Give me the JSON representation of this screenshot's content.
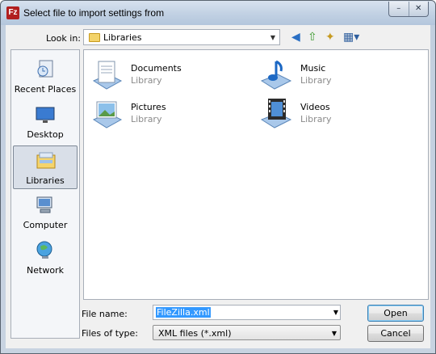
{
  "window": {
    "title": "Select file to import settings from",
    "app_icon": "Fz",
    "controls": [
      "–",
      "✕"
    ]
  },
  "lookin": {
    "label": "Look in:",
    "value": "Libraries"
  },
  "toolbar": {
    "back": "◀",
    "up": "⇧",
    "new_folder": "✦",
    "views": "▦▾"
  },
  "places": [
    {
      "label": "Recent Places",
      "icon": "recent-places-icon"
    },
    {
      "label": "Desktop",
      "icon": "desktop-icon"
    },
    {
      "label": "Libraries",
      "icon": "libraries-icon",
      "selected": true
    },
    {
      "label": "Computer",
      "icon": "computer-icon"
    },
    {
      "label": "Network",
      "icon": "network-icon"
    }
  ],
  "items": [
    {
      "name": "Documents",
      "sub": "Library",
      "icon": "documents-library-icon"
    },
    {
      "name": "Music",
      "sub": "Library",
      "icon": "music-library-icon"
    },
    {
      "name": "Pictures",
      "sub": "Library",
      "icon": "pictures-library-icon"
    },
    {
      "name": "Videos",
      "sub": "Library",
      "icon": "videos-library-icon"
    }
  ],
  "file_name": {
    "label": "File name:",
    "value": "FileZilla.xml"
  },
  "file_type": {
    "label": "Files of type:",
    "value": "XML files (*.xml)"
  },
  "buttons": {
    "open": "Open",
    "cancel": "Cancel"
  }
}
